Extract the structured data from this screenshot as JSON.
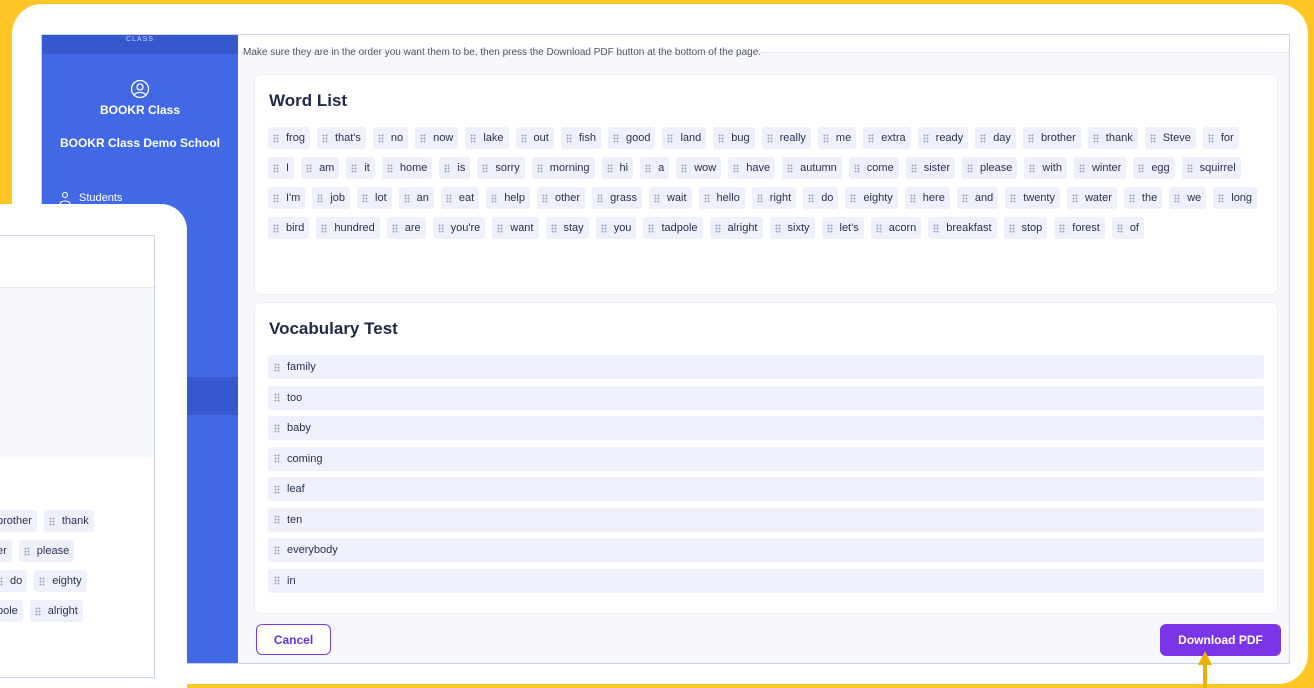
{
  "sidebar": {
    "top_label": "CLASS",
    "class_name": "BOOKR Class",
    "school_name": "BOOKR Class Demo School",
    "nav_students": "Students"
  },
  "main": {
    "instruction": "Make sure they are in the order you want them to be, then press the Download PDF button at the bottom of the page."
  },
  "word_list": {
    "title": "Word List",
    "words": [
      "frog",
      "that's",
      "no",
      "now",
      "lake",
      "out",
      "fish",
      "good",
      "land",
      "bug",
      "really",
      "me",
      "extra",
      "ready",
      "day",
      "brother",
      "thank",
      "Steve",
      "for",
      "I",
      "am",
      "it",
      "home",
      "is",
      "sorry",
      "morning",
      "hi",
      "a",
      "wow",
      "have",
      "autumn",
      "come",
      "sister",
      "please",
      "with",
      "winter",
      "egg",
      "squirrel",
      "I'm",
      "job",
      "lot",
      "an",
      "eat",
      "help",
      "other",
      "grass",
      "wait",
      "hello",
      "right",
      "do",
      "eighty",
      "here",
      "and",
      "twenty",
      "water",
      "the",
      "we",
      "long",
      "bird",
      "hundred",
      "are",
      "you're",
      "want",
      "stay",
      "you",
      "tadpole",
      "alright",
      "sixty",
      "let's",
      "acorn",
      "breakfast",
      "stop",
      "forest",
      "of"
    ]
  },
  "vocab_test": {
    "title": "Vocabulary Test",
    "words": [
      "family",
      "too",
      "baby",
      "coming",
      "leaf",
      "ten",
      "everybody",
      "in"
    ]
  },
  "actions": {
    "cancel": "Cancel",
    "download": "Download PDF"
  },
  "zoom": {
    "row1": [
      "brother",
      "thank"
    ],
    "row2": [
      "er",
      "please"
    ],
    "row3": [
      "do",
      "eighty"
    ],
    "row4": [
      "pole",
      "alright"
    ]
  },
  "colors": {
    "background": "#FFC526",
    "sidebar": "#4169e5",
    "accent": "#7a36e6",
    "arrow": "#E8B100"
  }
}
